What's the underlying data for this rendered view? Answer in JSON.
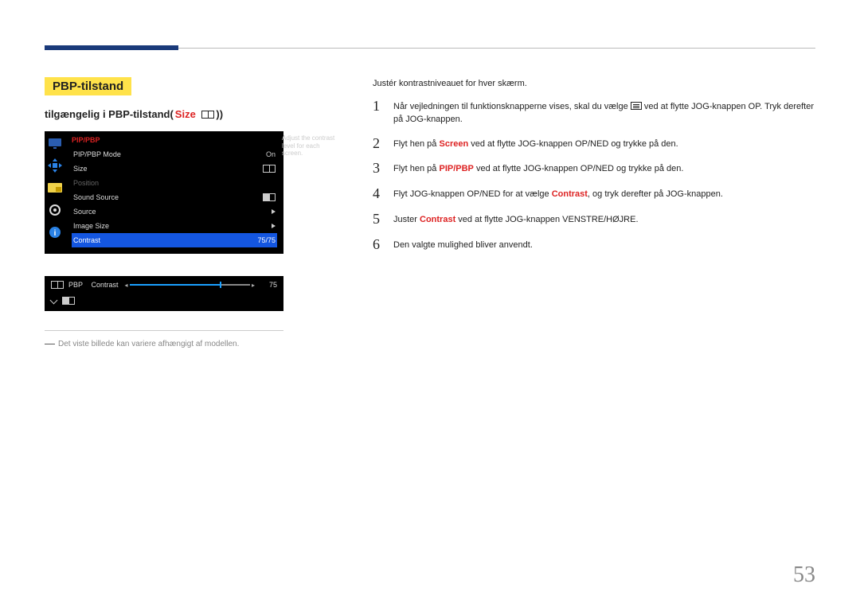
{
  "page_number": "53",
  "header": {
    "section_title": "PBP-tilstand"
  },
  "subhead": {
    "prefix": "tilgængelig i PBP-tilstand(",
    "accent": "Size",
    "suffix": "))"
  },
  "osd": {
    "category": "PIP/PBP",
    "tooltip": "Adjust the contrast level for each screen.",
    "rows": [
      {
        "label": "PIP/PBP Mode",
        "value": "On",
        "type": "text",
        "selected": false,
        "disabled": false
      },
      {
        "label": "Size",
        "value": "",
        "type": "split-icon",
        "selected": false,
        "disabled": false
      },
      {
        "label": "Position",
        "value": "",
        "type": "none",
        "selected": false,
        "disabled": true
      },
      {
        "label": "Sound Source",
        "value": "",
        "type": "split-half-icon",
        "selected": false,
        "disabled": false
      },
      {
        "label": "Source",
        "value": "",
        "type": "arrow",
        "selected": false,
        "disabled": false
      },
      {
        "label": "Image Size",
        "value": "",
        "type": "arrow",
        "selected": false,
        "disabled": false
      },
      {
        "label": "Contrast",
        "value": "75/75",
        "type": "text",
        "selected": true,
        "disabled": false
      }
    ]
  },
  "slider": {
    "group_label": "PBP",
    "item_label": "Contrast",
    "left_arrow": "◂",
    "right_arrow": "▸",
    "value": "75",
    "percent": 75
  },
  "footnote": "Det viste billede kan variere afhængigt af modellen.",
  "right": {
    "intro": "Justér kontrastniveauet for hver skærm.",
    "steps": [
      {
        "n": "1",
        "pre": "Når vejledningen til funktionsknapperne vises, skal du vælge ",
        "icon": "menu",
        "post": " ved at flytte JOG-knappen OP. Tryk derefter på JOG-knappen."
      },
      {
        "n": "2",
        "pre": "Flyt hen på ",
        "accent": "Screen",
        "post": " ved at flytte JOG-knappen OP/NED og trykke på den."
      },
      {
        "n": "3",
        "pre": "Flyt hen på ",
        "accent": "PIP/PBP",
        "post": " ved at flytte JOG-knappen OP/NED og trykke på den."
      },
      {
        "n": "4",
        "pre": "Flyt JOG-knappen OP/NED for at vælge ",
        "accent": "Contrast",
        "post": ", og tryk derefter på JOG-knappen."
      },
      {
        "n": "5",
        "pre": "Juster ",
        "accent": "Contrast",
        "post": " ved at flytte JOG-knappen VENSTRE/HØJRE."
      },
      {
        "n": "6",
        "pre": "Den valgte mulighed bliver anvendt.",
        "post": ""
      }
    ]
  }
}
